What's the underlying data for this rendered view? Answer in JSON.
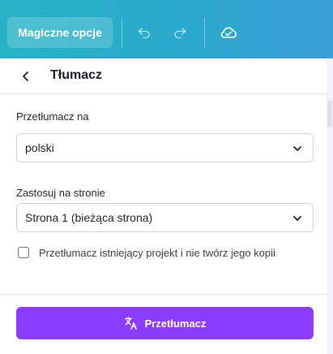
{
  "toolbar": {
    "magic_label": "Magiczne opcje",
    "undo_icon": "undo-icon",
    "redo_icon": "redo-icon",
    "cloud_icon": "cloud-check-icon"
  },
  "panel": {
    "title": "Tłumacz",
    "back_icon": "chevron-left-icon",
    "translate_to_label": "Przetłumacz na",
    "language_value": "polski",
    "apply_label": "Zastosuj na stronie",
    "page_value": "Strona 1 (bieżąca strona)",
    "checkbox_text": "Przetłumacz istniejący projekt i nie twórz jego kopii",
    "checkbox_checked": false,
    "button_label": "Przetłumacz",
    "button_icon": "translate-icon"
  },
  "colors": {
    "topbar": "#2aa9cc",
    "accent": "#8b3dff",
    "text": "#1f2328"
  }
}
